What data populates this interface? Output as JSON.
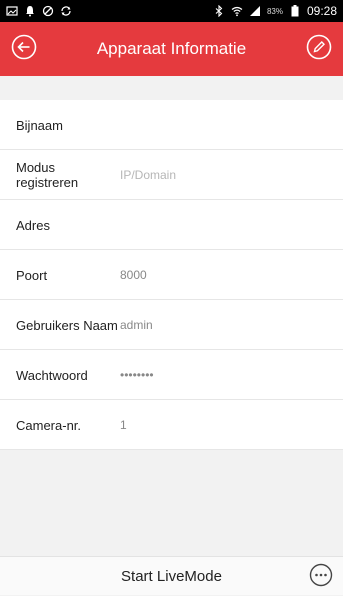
{
  "status_bar": {
    "time": "09:28",
    "battery_percent": "83%",
    "left_icons": [
      "image-icon",
      "notification-icon",
      "block-icon",
      "sync-icon"
    ],
    "right_icons": [
      "bluetooth-icon",
      "wifi-icon",
      "signal-icon",
      "battery-icon"
    ]
  },
  "header": {
    "title": "Apparaat Informatie",
    "background_color": "#e53a3e",
    "back_icon": "back-arrow-icon",
    "edit_icon": "pencil-icon"
  },
  "form": {
    "fields": [
      {
        "label": "Bijnaam",
        "value": "",
        "placeholder": ""
      },
      {
        "label": "Modus registreren",
        "value": "",
        "placeholder": "IP/Domain"
      },
      {
        "label": "Adres",
        "value": "",
        "placeholder": ""
      },
      {
        "label": "Poort",
        "value": "8000",
        "placeholder": ""
      },
      {
        "label": "Gebruikers Naam",
        "value": "admin",
        "placeholder": ""
      },
      {
        "label": "Wachtwoord",
        "value": "••••••••",
        "placeholder": ""
      },
      {
        "label": "Camera-nr.",
        "value": "1",
        "placeholder": ""
      }
    ]
  },
  "bottom": {
    "start_live_label": "Start LiveMode",
    "more_icon": "more-options-icon"
  }
}
